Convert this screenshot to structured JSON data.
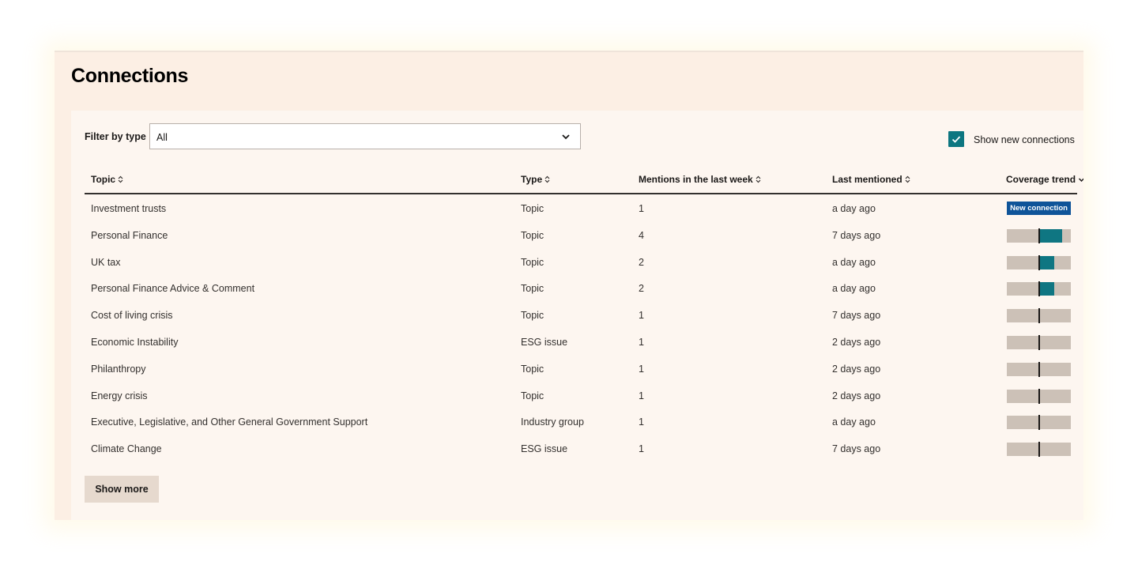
{
  "page": {
    "title": "Connections"
  },
  "filter": {
    "label": "Filter by type",
    "selected": "All"
  },
  "toggle": {
    "label": "Show new connections",
    "checked": true
  },
  "table": {
    "columns": {
      "topic": "Topic",
      "type": "Type",
      "mentions": "Mentions in the last week",
      "last": "Last mentioned",
      "trend": "Coverage trend"
    },
    "rows": [
      {
        "topic": "Investment trusts",
        "type": "Topic",
        "mentions": "1",
        "last": "a day ago",
        "badge": "New connection",
        "trend": null
      },
      {
        "topic": "Personal Finance",
        "type": "Topic",
        "mentions": "4",
        "last": "7 days ago",
        "trend": 0.75
      },
      {
        "topic": "UK tax",
        "type": "Topic",
        "mentions": "2",
        "last": "a day ago",
        "trend": 0.5
      },
      {
        "topic": "Personal Finance Advice & Comment",
        "type": "Topic",
        "mentions": "2",
        "last": "a day ago",
        "trend": 0.5
      },
      {
        "topic": "Cost of living crisis",
        "type": "Topic",
        "mentions": "1",
        "last": "7 days ago",
        "trend": 0
      },
      {
        "topic": "Economic Instability",
        "type": "ESG issue",
        "mentions": "1",
        "last": "2 days ago",
        "trend": 0
      },
      {
        "topic": "Philanthropy",
        "type": "Topic",
        "mentions": "1",
        "last": "2 days ago",
        "trend": 0
      },
      {
        "topic": "Energy crisis",
        "type": "Topic",
        "mentions": "1",
        "last": "2 days ago",
        "trend": 0
      },
      {
        "topic": "Executive, Legislative, and Other General Government Support",
        "type": "Industry group",
        "mentions": "1",
        "last": "a day ago",
        "trend": 0
      },
      {
        "topic": "Climate Change",
        "type": "ESG issue",
        "mentions": "1",
        "last": "7 days ago",
        "trend": 0
      }
    ]
  },
  "actions": {
    "show_more": "Show more"
  },
  "colors": {
    "accent": "#0d7680",
    "badge": "#0f5499",
    "background": "#fcefe4"
  },
  "icons": {
    "sort": "sort-icon",
    "dropdown": "chevron-down-icon",
    "check": "check-icon"
  }
}
